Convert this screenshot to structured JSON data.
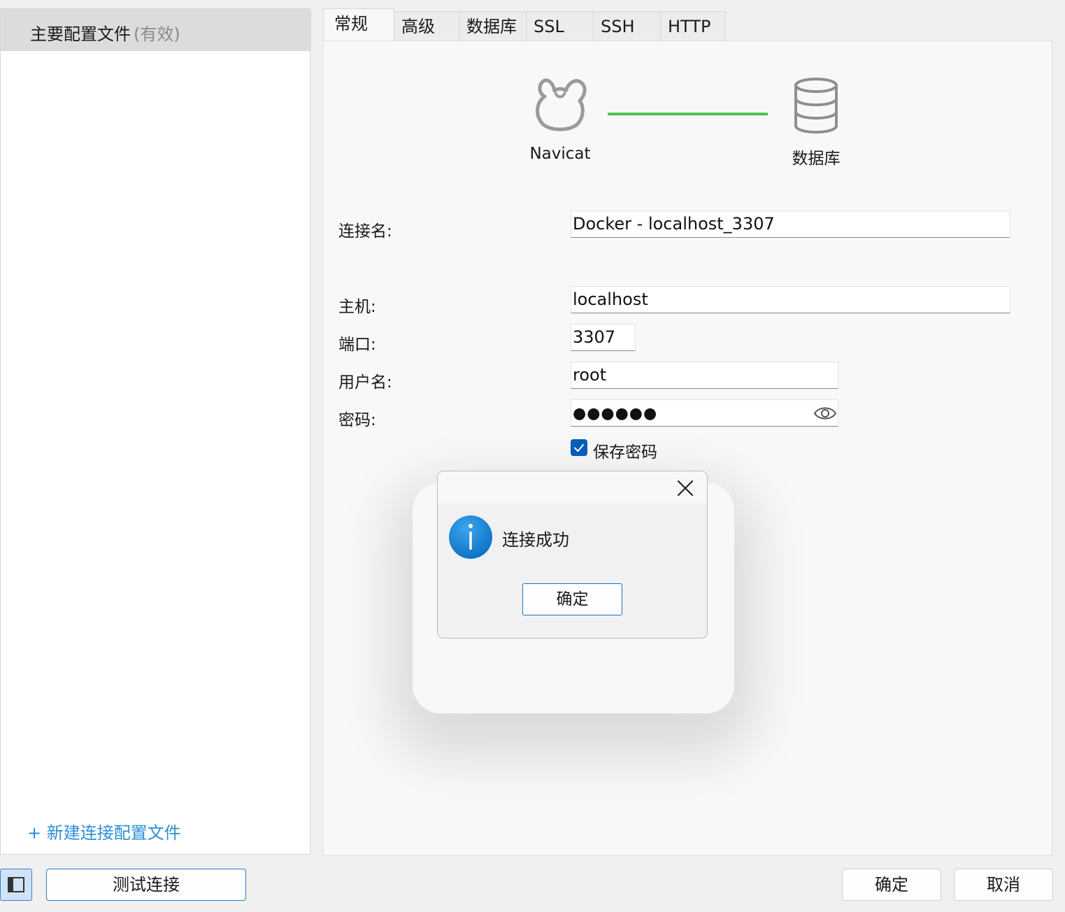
{
  "sidebar": {
    "profile_name": "主要配置文件",
    "profile_status": "(有效)",
    "new_profile": "+ 新建连接配置文件"
  },
  "tabs": [
    {
      "label": "常规",
      "active": true
    },
    {
      "label": "高级"
    },
    {
      "label": "数据库"
    },
    {
      "label": "SSL"
    },
    {
      "label": "SSH"
    },
    {
      "label": "HTTP"
    }
  ],
  "diagram": {
    "left_label": "Navicat",
    "right_label": "数据库",
    "line_color": "#4cc54c",
    "left_icon": "navicat-logo-icon",
    "right_icon": "database-icon"
  },
  "form": {
    "connection_name_label": "连接名:",
    "connection_name_value": "Docker - localhost_3307",
    "host_label": "主机:",
    "host_value": "localhost",
    "port_label": "端口:",
    "port_value": "3307",
    "username_label": "用户名:",
    "username_value": "root",
    "password_label": "密码:",
    "password_value": "●●●●●●",
    "save_password_label": "保存密码",
    "save_password_checked": true
  },
  "dialog": {
    "message": "连接成功",
    "ok_label": "确定",
    "icon": "info-icon"
  },
  "footer": {
    "test_connection": "测试连接",
    "ok": "确定",
    "cancel": "取消"
  },
  "colors": {
    "accent": "#005fb8",
    "link": "#2b8fd4"
  }
}
